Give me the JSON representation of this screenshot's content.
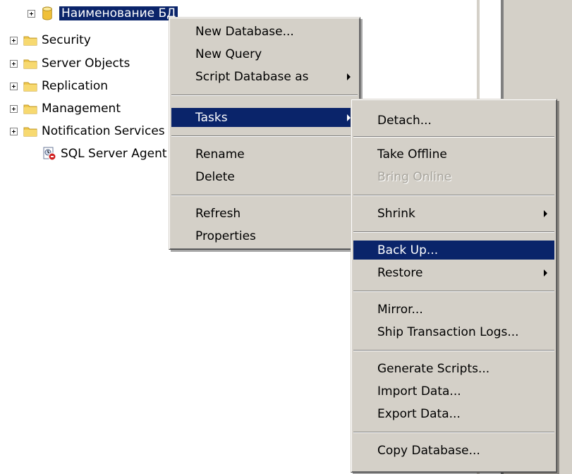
{
  "tree": {
    "database_label": "Наименование БД",
    "items": [
      {
        "label": "Security"
      },
      {
        "label": "Server Objects"
      },
      {
        "label": "Replication"
      },
      {
        "label": "Management"
      },
      {
        "label": "Notification Services"
      },
      {
        "label": "SQL Server Agent"
      }
    ]
  },
  "context_menu": {
    "items": [
      {
        "label": "New Database..."
      },
      {
        "label": "New Query"
      },
      {
        "label": "Script Database as"
      },
      {
        "label": "Tasks"
      },
      {
        "label": "Rename"
      },
      {
        "label": "Delete"
      },
      {
        "label": "Refresh"
      },
      {
        "label": "Properties"
      }
    ]
  },
  "tasks_menu": {
    "items": [
      {
        "label": "Detach..."
      },
      {
        "label": "Take Offline"
      },
      {
        "label": "Bring Online"
      },
      {
        "label": "Shrink"
      },
      {
        "label": "Back Up..."
      },
      {
        "label": "Restore"
      },
      {
        "label": "Mirror..."
      },
      {
        "label": "Ship Transaction Logs..."
      },
      {
        "label": "Generate Scripts..."
      },
      {
        "label": "Import Data..."
      },
      {
        "label": "Export Data..."
      },
      {
        "label": "Copy Database..."
      }
    ]
  },
  "colors": {
    "menu_bg": "#d4d0c8",
    "highlight": "#0a246a",
    "folder": "#f0c84c",
    "disabled_text": "#a7a49c"
  },
  "icons": {
    "expander": "plus-box-icon",
    "database": "database-cylinder-icon",
    "folder": "folder-icon",
    "agent": "sql-agent-icon",
    "submenu": "submenu-arrow-icon"
  }
}
